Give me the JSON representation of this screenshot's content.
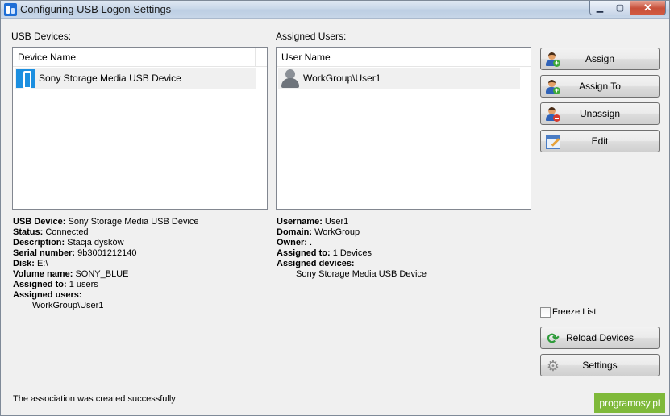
{
  "window": {
    "title": "Configuring USB Logon Settings"
  },
  "usb_devices": {
    "label": "USB Devices:",
    "column": "Device Name",
    "items": [
      {
        "name": "Sony Storage Media USB Device",
        "icon": "usb-drive-icon"
      }
    ]
  },
  "assigned_users": {
    "label": "Assigned Users:",
    "column": "User Name",
    "items": [
      {
        "name": "WorkGroup\\User1",
        "icon": "user-icon"
      }
    ]
  },
  "device_info": {
    "usb_device_label": "USB Device:",
    "usb_device": "Sony Storage Media USB Device",
    "status_label": "Status:",
    "status": "Connected",
    "description_label": "Description:",
    "description": "Stacja dysków",
    "serial_label": "Serial number:",
    "serial": "9b3001212140",
    "disk_label": "Disk:",
    "disk": "E:\\",
    "volume_label": "Volume name:",
    "volume": "SONY_BLUE",
    "assigned_to_label": "Assigned to:",
    "assigned_to": "1 users",
    "assigned_users_label": "Assigned users:",
    "assigned_users": "WorkGroup\\User1"
  },
  "user_info": {
    "username_label": "Username:",
    "username": "User1",
    "domain_label": "Domain:",
    "domain": "WorkGroup",
    "owner_label": "Owner:",
    "owner": ".",
    "assigned_to_label": "Assigned to:",
    "assigned_to": "1 Devices",
    "assigned_devices_label": "Assigned devices:",
    "assigned_devices": "Sony Storage Media USB Device"
  },
  "buttons": {
    "assign": "Assign",
    "assign_to": "Assign To",
    "unassign": "Unassign",
    "edit": "Edit",
    "reload": "Reload Devices",
    "settings": "Settings"
  },
  "freeze_list": {
    "label": "Freeze List",
    "checked": false
  },
  "status_text": "The association was created successfully",
  "watermark": "programosy.pl",
  "colors": {
    "accent": "#1c8fe0",
    "watermark": "#7fb93a"
  }
}
